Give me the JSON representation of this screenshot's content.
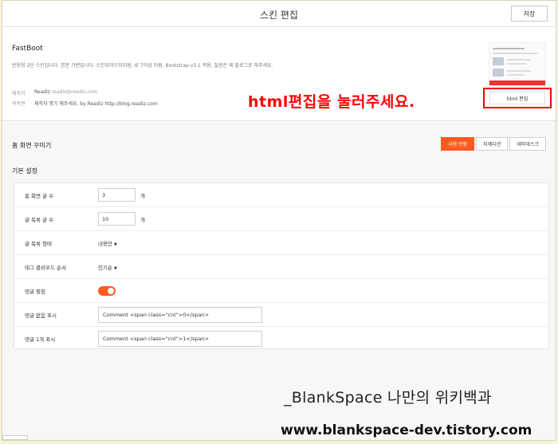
{
  "header": {
    "title": "스킨 편집",
    "save_label": "저장"
  },
  "skin": {
    "name": "FastBoot",
    "description": "반응형 2단 스킨입니다. 본문 가변입니다. 스킨위자드미지원, IE 7이상 지원, Bootstrap v3.1 적용, 질문은 제 블로그로 해주세요.",
    "author_key": "제작자",
    "author_name": "Readiz",
    "author_email": "readiz@readiz.com",
    "copyright_key": "저작권",
    "copyright_value": "제작자 명기 해주세요. by Readiz http://blog.readiz.com",
    "html_edit_label": "html 편집"
  },
  "annotation": "html편집을 눌러주세요.",
  "home": {
    "title": "홈 화면 꾸미기",
    "tabs": [
      "사용 안함",
      "티에디션",
      "테마데스크"
    ],
    "active_tab": 0,
    "section_title": "기본 설정",
    "settings": [
      {
        "label": "홈 화면 글 수",
        "value": "3",
        "unit": "개"
      },
      {
        "label": "글 목록 글 수",
        "value": "10",
        "unit": "개"
      },
      {
        "label": "글 목록 형태",
        "value": "내용만"
      },
      {
        "label": "태그 클라우드 순서",
        "value": "인기순"
      },
      {
        "label": "댓글 펼침",
        "toggle_on": true
      },
      {
        "label": "댓글 없음 표시",
        "value": "Comment <span class=\"cnt\">0</span>"
      },
      {
        "label": "댓글 1개 표시",
        "value": "Comment <span class=\"cnt\">1</span>"
      }
    ]
  },
  "watermark": {
    "line1": "_BlankSpace 나만의 위키백과",
    "line2": "www.blankspace-dev.tistory.com"
  },
  "colors": {
    "accent": "#ff5a1f",
    "annotation_red": "#ff0000",
    "page_bg": "#f6f3d9"
  }
}
